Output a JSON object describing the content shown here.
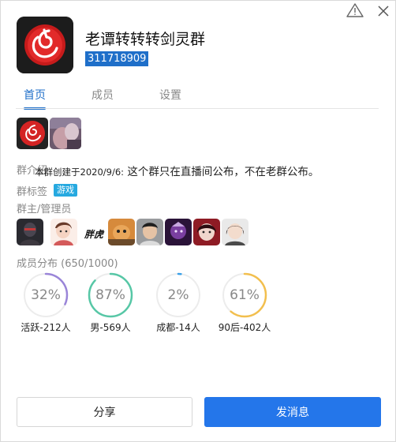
{
  "header": {
    "title": "老谭转转转剑灵群",
    "group_id": "311718909"
  },
  "icons": {
    "warning": "warning-triangle-icon",
    "close": "close-x-icon"
  },
  "tabs": [
    {
      "label": "首页",
      "active": true
    },
    {
      "label": "成员",
      "active": false
    },
    {
      "label": "设置",
      "active": false
    }
  ],
  "intro": {
    "label": "群介绍",
    "text_small": "本群创建于2020/9/6:",
    "text_large": " 这个群只在直播间公布，不在老群公布。"
  },
  "tags": {
    "label": "群标签",
    "items": [
      "游戏"
    ]
  },
  "admins": {
    "label": "群主/管理员",
    "text_avatar": "胖虎"
  },
  "distribution": {
    "label": "成员分布",
    "count": "(650/1000)",
    "gauges": [
      {
        "value": "32%",
        "label": "活跃-212人",
        "fraction": 0.32,
        "color": "#9a85d8"
      },
      {
        "value": "87%",
        "label": "男-569人",
        "fraction": 0.87,
        "color": "#57c7a6"
      },
      {
        "value": "2%",
        "label": "成都-14人",
        "fraction": 0.02,
        "color": "#3aa0e8"
      },
      {
        "value": "61%",
        "label": "90后-402人",
        "fraction": 0.61,
        "color": "#f2bf4e"
      }
    ]
  },
  "buttons": {
    "share": "分享",
    "send": "发消息"
  },
  "colors": {
    "accent": "#1f6fc9",
    "primary_button": "#2476ea",
    "tag": "#26a9e0"
  }
}
